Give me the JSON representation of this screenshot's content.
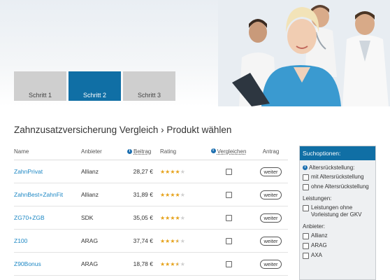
{
  "steps": [
    {
      "label": "Schritt 1",
      "active": false
    },
    {
      "label": "Schritt 2",
      "active": true
    },
    {
      "label": "Schritt 3",
      "active": false
    }
  ],
  "page_title": "Zahnzusatzversicherung Vergleich › Produkt wählen",
  "table": {
    "headers": {
      "name": "Name",
      "provider": "Anbieter",
      "price": "Beitrag",
      "rating": "Rating",
      "compare": "Vergleichen",
      "apply": "Antrag"
    },
    "rows": [
      {
        "name": "ZahnPrivat",
        "provider": "Allianz",
        "price": "28,27 €",
        "stars": 4,
        "button": "weiter"
      },
      {
        "name": "ZahnBest+ZahnFit",
        "provider": "Allianz",
        "price": "31,89 €",
        "stars": 4,
        "button": "weiter"
      },
      {
        "name": "ZG70+ZGB",
        "provider": "SDK",
        "price": "35,05 €",
        "stars": 4,
        "button": "weiter"
      },
      {
        "name": "Z100",
        "provider": "ARAG",
        "price": "37,74 €",
        "stars": 3.5,
        "button": "weiter"
      },
      {
        "name": "Z90Bonus",
        "provider": "ARAG",
        "price": "18,78 €",
        "stars": 3.5,
        "button": "weiter"
      }
    ]
  },
  "panel": {
    "title": "Suchoptionen:",
    "section1": "Altersrückstellung:",
    "opt1": "mit Altersrückstellung",
    "opt2": "ohne Altersrückstellung",
    "section2": "Leistungen:",
    "opt3": "Leistungen ohne Vorleistung der GKV",
    "section3": "Anbieter:",
    "prov1": "Allianz",
    "prov2": "ARAG",
    "prov3": "AXA"
  },
  "colors": {
    "accent": "#106fa5",
    "link": "#1c87c4",
    "star": "#e6a21a"
  }
}
